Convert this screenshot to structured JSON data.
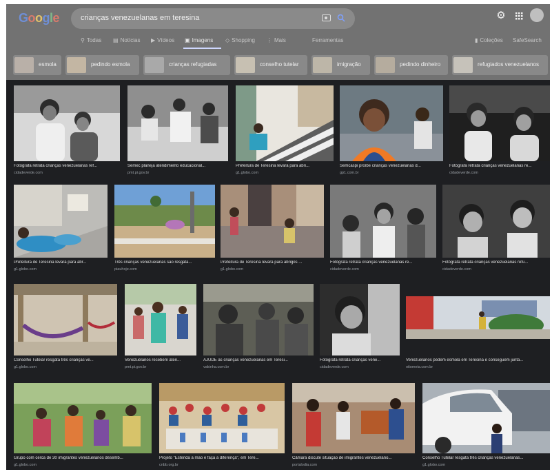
{
  "header": {
    "logo": "Google",
    "search_query": "crianças venezuelanas em teresina"
  },
  "tabs": [
    {
      "label": "Todas",
      "icon": "search-icon"
    },
    {
      "label": "Notícias",
      "icon": "newspaper-icon"
    },
    {
      "label": "Vídeos",
      "icon": "video-icon"
    },
    {
      "label": "Imagens",
      "icon": "image-icon",
      "active": true
    },
    {
      "label": "Shopping",
      "icon": "tag-icon"
    },
    {
      "label": "Mais",
      "icon": "more-icon"
    },
    {
      "label": "Ferramentas"
    }
  ],
  "right_tools": {
    "collections": "Coleções",
    "safesearch": "SafeSearch"
  },
  "chips": [
    {
      "label": "esmola"
    },
    {
      "label": "pedindo esmola"
    },
    {
      "label": "crianças refugiadas"
    },
    {
      "label": "conselho tutelar"
    },
    {
      "label": "imigração"
    },
    {
      "label": "pedindo dinheiro"
    },
    {
      "label": "refugiados venezuelanos"
    }
  ],
  "results": [
    {
      "caption": "Fotógrafa retrata crianças venezuelanas ref...",
      "source": "cidadeverde.com"
    },
    {
      "caption": "Semec planeja atendimento educacional...",
      "source": "pmt.pi.gov.br"
    },
    {
      "caption": "Prefeitura de Teresina levará para abri...",
      "source": "g1.globo.com"
    },
    {
      "caption": "Semcaspi proíbe crianças venezuelanas d...",
      "source": "gp1.com.br"
    },
    {
      "caption": "Fotógrafa retrata crianças venezuelanas re...",
      "source": "cidadeverde.com"
    },
    {
      "caption": "Prefeitura de Teresina levará para abr...",
      "source": "g1.globo.com"
    },
    {
      "caption": "Três crianças venezuelanas são resgata...",
      "source": "piauhoje.com"
    },
    {
      "caption": "Prefeitura de Teresina levará para abrigos ...",
      "source": "g1.globo.com"
    },
    {
      "caption": "Fotógrafa retrata crianças venezuelanas re...",
      "source": "cidadeverde.com"
    },
    {
      "caption": "Fotógrafa retrata crianças venezuelanas refu...",
      "source": "cidadeverde.com"
    },
    {
      "caption": "Conselho Tutelar resgata três crianças ve...",
      "source": "g1.globo.com"
    },
    {
      "caption": "Venezuelanos recebem aten...",
      "source": "pmt.pi.gov.br"
    },
    {
      "caption": "AJUDE as crianças venezuelanas em Teresi...",
      "source": "vakinha.com.br"
    },
    {
      "caption": "Fotógrafa retrata crianças vene...",
      "source": "cidadeverde.com"
    },
    {
      "caption": "Venezuelanos pedem esmola em Teresina e conseguem junta...",
      "source": "oitomeia.com.br"
    },
    {
      "caption": "Grupo com cerca de 30 imigrantes venezuelanos desemb...",
      "source": "g1.globo.com"
    },
    {
      "caption": "Projeto \"Estenda a mão e faça a diferença\", em Tere...",
      "source": "cnbb.org.br"
    },
    {
      "caption": "Câmara discute situação de imigrantes venezuelano...",
      "source": "portalodia.com"
    },
    {
      "caption": "Conselho Tutelar resgata três crianças venezuelanas...",
      "source": "g1.globo.com"
    }
  ]
}
